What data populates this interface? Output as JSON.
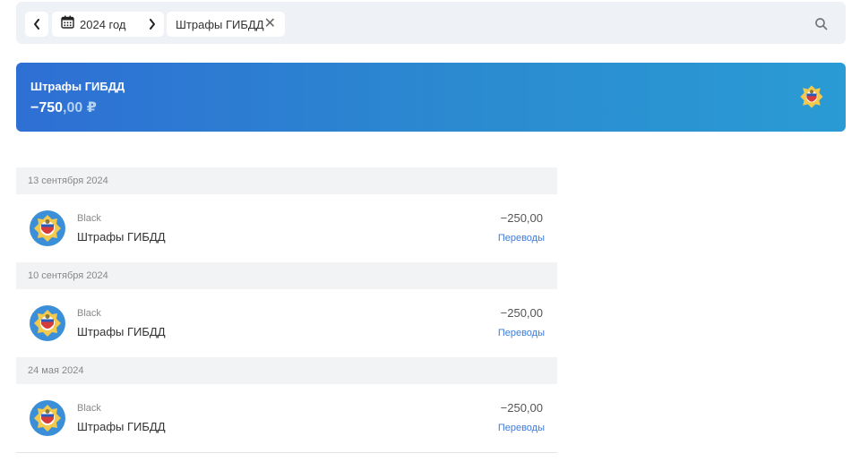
{
  "filters": {
    "period_label": "2024 год",
    "tag_label": "Штрафы ГИБДД"
  },
  "summary": {
    "title": "Штрафы ГИБДД",
    "amount_int": "−750",
    "amount_frac": ",00 ₽"
  },
  "groups": [
    {
      "date": "13 сентября 2024",
      "transactions": [
        {
          "account": "Black",
          "name": "Штрафы ГИБДД",
          "amount": "−250,00",
          "category": "Переводы"
        }
      ]
    },
    {
      "date": "10 сентября 2024",
      "transactions": [
        {
          "account": "Black",
          "name": "Штрафы ГИБДД",
          "amount": "−250,00",
          "category": "Переводы"
        }
      ]
    },
    {
      "date": "24 мая 2024",
      "transactions": [
        {
          "account": "Black",
          "name": "Штрафы ГИБДД",
          "amount": "−250,00",
          "category": "Переводы"
        }
      ]
    }
  ],
  "icons": {
    "prev": "chevron-left-icon",
    "next": "chevron-right-icon",
    "calendar": "calendar-icon",
    "close": "close-icon",
    "search": "search-icon",
    "emblem": "gibdd-emblem-icon"
  },
  "colors": {
    "banner_start": "#2e6fd4",
    "banner_end": "#2a9bd4",
    "link": "#3d7bd6",
    "emblem_circle": "#3a8fd8"
  }
}
